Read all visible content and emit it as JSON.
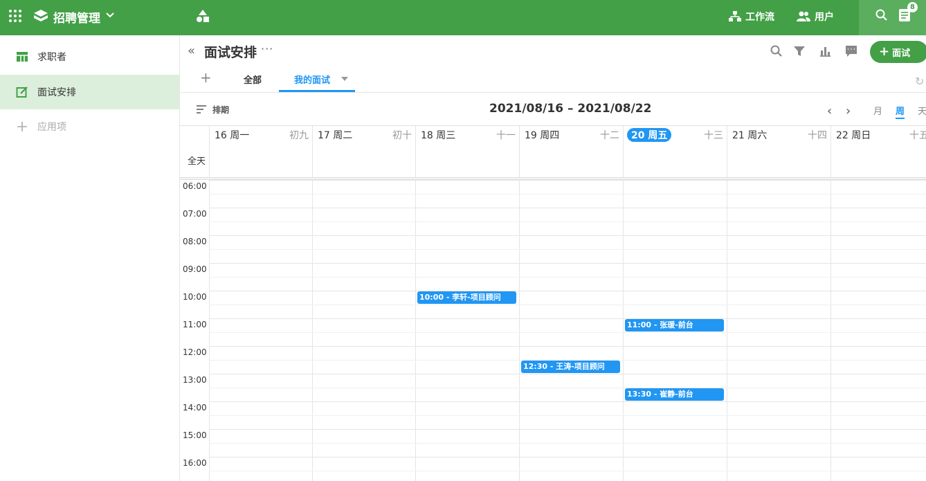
{
  "topbar": {
    "app_title": "招聘管理",
    "workflow_label": "工作流",
    "users_label": "用户",
    "badge_count": "8"
  },
  "sidebar": {
    "items": [
      {
        "label": "求职者"
      },
      {
        "label": "面试安排"
      },
      {
        "label": "应用项"
      }
    ]
  },
  "page": {
    "title": "面试安排",
    "more": "···",
    "add_label": "面试"
  },
  "tabs": {
    "plus": "+",
    "all": "全部",
    "mine": "我的面试"
  },
  "calendar": {
    "sort_label": "排期",
    "range": "2021/08/16 – 2021/08/22",
    "views": {
      "month": "月",
      "week": "周",
      "day": "天"
    },
    "allday_label": "全天",
    "days": [
      {
        "name": "16 周一",
        "lunar": "初九"
      },
      {
        "name": "17 周二",
        "lunar": "初十"
      },
      {
        "name": "18 周三",
        "lunar": "十一"
      },
      {
        "name": "19 周四",
        "lunar": "十二"
      },
      {
        "name": "20 周五",
        "lunar": "十三"
      },
      {
        "name": "21 周六",
        "lunar": "十四"
      },
      {
        "name": "22 周日",
        "lunar": "十五"
      }
    ],
    "hours": [
      "06:00",
      "07:00",
      "08:00",
      "09:00",
      "10:00",
      "11:00",
      "12:00",
      "13:00",
      "14:00",
      "15:00",
      "16:00"
    ],
    "events": [
      {
        "day": 2,
        "time": "10:00",
        "label": "10:00 -  李轩-项目顾问"
      },
      {
        "day": 4,
        "time": "11:00",
        "label": "11:00 -  张瑗-前台"
      },
      {
        "day": 3,
        "time": "12:30",
        "label": "12:30 -  王涛-项目顾问"
      },
      {
        "day": 4,
        "time": "13:30",
        "label": "13:30 -  崔静-前台"
      }
    ]
  },
  "colors": {
    "brand": "#43a047",
    "accent": "#2196f3"
  }
}
